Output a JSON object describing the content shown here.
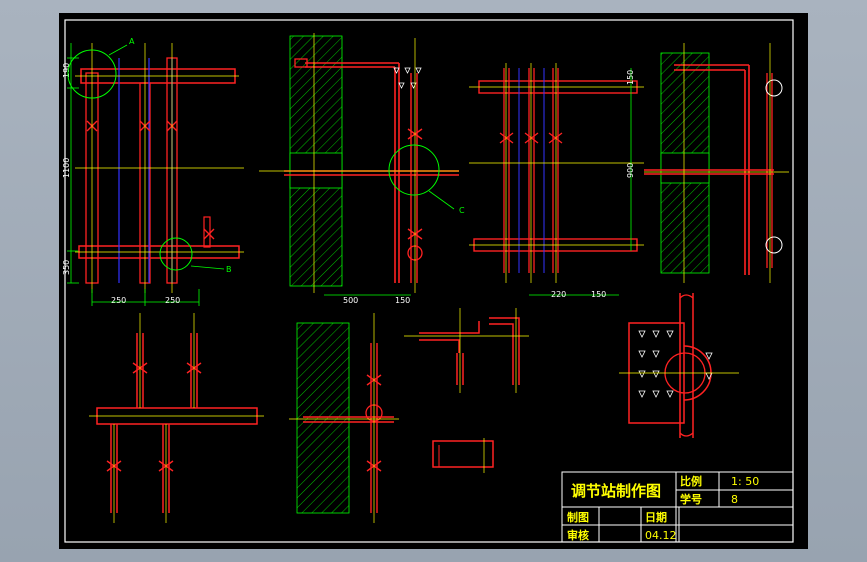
{
  "drawing": {
    "title": "调节站制作图",
    "scale_label": "比例",
    "scale_value": "1: 50",
    "sheet_no_label": "学号",
    "sheet_no_value": "8",
    "drawn_by_label": "制图",
    "date_label": "日期",
    "checked_by_label": "审核",
    "date_value": "04.12"
  },
  "callouts": {
    "a": "A",
    "b": "B",
    "c": "C"
  },
  "dims": {
    "d190": "190",
    "d1100": "1100",
    "d350": "350",
    "d250a": "250",
    "d250b": "250",
    "d500": "500",
    "d150a": "150",
    "d150b": "150",
    "d900": "900",
    "d220": "220",
    "d150c": "150"
  },
  "colors": {
    "frame": "#ffffff",
    "pipe": "#ff2020",
    "centerline": "#ffff00",
    "dimension": "#00ff00",
    "wall_hatch": "#00d000",
    "detail_circle": "#00ff00",
    "inner_pipe": "#3050ff",
    "title_text": "#ffff00"
  }
}
